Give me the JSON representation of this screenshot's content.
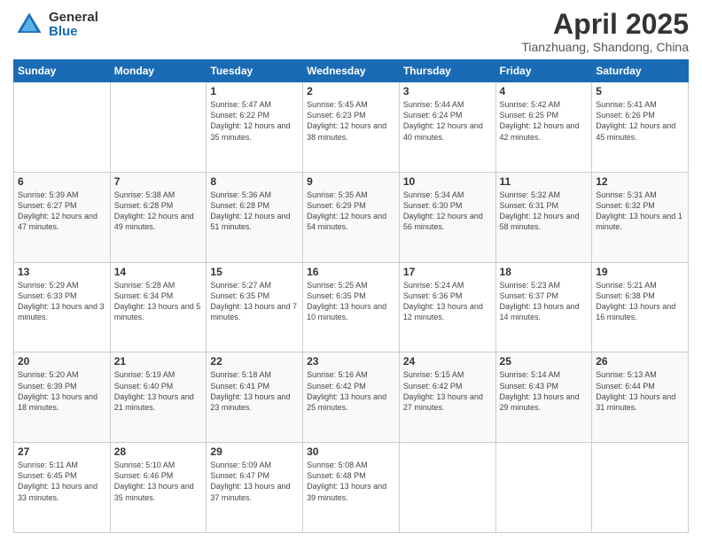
{
  "header": {
    "logo_general": "General",
    "logo_blue": "Blue",
    "title": "April 2025",
    "location": "Tianzhuang, Shandong, China"
  },
  "days_of_week": [
    "Sunday",
    "Monday",
    "Tuesday",
    "Wednesday",
    "Thursday",
    "Friday",
    "Saturday"
  ],
  "weeks": [
    [
      {
        "num": "",
        "info": ""
      },
      {
        "num": "",
        "info": ""
      },
      {
        "num": "1",
        "info": "Sunrise: 5:47 AM\nSunset: 6:22 PM\nDaylight: 12 hours and 35 minutes."
      },
      {
        "num": "2",
        "info": "Sunrise: 5:45 AM\nSunset: 6:23 PM\nDaylight: 12 hours and 38 minutes."
      },
      {
        "num": "3",
        "info": "Sunrise: 5:44 AM\nSunset: 6:24 PM\nDaylight: 12 hours and 40 minutes."
      },
      {
        "num": "4",
        "info": "Sunrise: 5:42 AM\nSunset: 6:25 PM\nDaylight: 12 hours and 42 minutes."
      },
      {
        "num": "5",
        "info": "Sunrise: 5:41 AM\nSunset: 6:26 PM\nDaylight: 12 hours and 45 minutes."
      }
    ],
    [
      {
        "num": "6",
        "info": "Sunrise: 5:39 AM\nSunset: 6:27 PM\nDaylight: 12 hours and 47 minutes."
      },
      {
        "num": "7",
        "info": "Sunrise: 5:38 AM\nSunset: 6:28 PM\nDaylight: 12 hours and 49 minutes."
      },
      {
        "num": "8",
        "info": "Sunrise: 5:36 AM\nSunset: 6:28 PM\nDaylight: 12 hours and 51 minutes."
      },
      {
        "num": "9",
        "info": "Sunrise: 5:35 AM\nSunset: 6:29 PM\nDaylight: 12 hours and 54 minutes."
      },
      {
        "num": "10",
        "info": "Sunrise: 5:34 AM\nSunset: 6:30 PM\nDaylight: 12 hours and 56 minutes."
      },
      {
        "num": "11",
        "info": "Sunrise: 5:32 AM\nSunset: 6:31 PM\nDaylight: 12 hours and 58 minutes."
      },
      {
        "num": "12",
        "info": "Sunrise: 5:31 AM\nSunset: 6:32 PM\nDaylight: 13 hours and 1 minute."
      }
    ],
    [
      {
        "num": "13",
        "info": "Sunrise: 5:29 AM\nSunset: 6:33 PM\nDaylight: 13 hours and 3 minutes."
      },
      {
        "num": "14",
        "info": "Sunrise: 5:28 AM\nSunset: 6:34 PM\nDaylight: 13 hours and 5 minutes."
      },
      {
        "num": "15",
        "info": "Sunrise: 5:27 AM\nSunset: 6:35 PM\nDaylight: 13 hours and 7 minutes."
      },
      {
        "num": "16",
        "info": "Sunrise: 5:25 AM\nSunset: 6:35 PM\nDaylight: 13 hours and 10 minutes."
      },
      {
        "num": "17",
        "info": "Sunrise: 5:24 AM\nSunset: 6:36 PM\nDaylight: 13 hours and 12 minutes."
      },
      {
        "num": "18",
        "info": "Sunrise: 5:23 AM\nSunset: 6:37 PM\nDaylight: 13 hours and 14 minutes."
      },
      {
        "num": "19",
        "info": "Sunrise: 5:21 AM\nSunset: 6:38 PM\nDaylight: 13 hours and 16 minutes."
      }
    ],
    [
      {
        "num": "20",
        "info": "Sunrise: 5:20 AM\nSunset: 6:39 PM\nDaylight: 13 hours and 18 minutes."
      },
      {
        "num": "21",
        "info": "Sunrise: 5:19 AM\nSunset: 6:40 PM\nDaylight: 13 hours and 21 minutes."
      },
      {
        "num": "22",
        "info": "Sunrise: 5:18 AM\nSunset: 6:41 PM\nDaylight: 13 hours and 23 minutes."
      },
      {
        "num": "23",
        "info": "Sunrise: 5:16 AM\nSunset: 6:42 PM\nDaylight: 13 hours and 25 minutes."
      },
      {
        "num": "24",
        "info": "Sunrise: 5:15 AM\nSunset: 6:42 PM\nDaylight: 13 hours and 27 minutes."
      },
      {
        "num": "25",
        "info": "Sunrise: 5:14 AM\nSunset: 6:43 PM\nDaylight: 13 hours and 29 minutes."
      },
      {
        "num": "26",
        "info": "Sunrise: 5:13 AM\nSunset: 6:44 PM\nDaylight: 13 hours and 31 minutes."
      }
    ],
    [
      {
        "num": "27",
        "info": "Sunrise: 5:11 AM\nSunset: 6:45 PM\nDaylight: 13 hours and 33 minutes."
      },
      {
        "num": "28",
        "info": "Sunrise: 5:10 AM\nSunset: 6:46 PM\nDaylight: 13 hours and 35 minutes."
      },
      {
        "num": "29",
        "info": "Sunrise: 5:09 AM\nSunset: 6:47 PM\nDaylight: 13 hours and 37 minutes."
      },
      {
        "num": "30",
        "info": "Sunrise: 5:08 AM\nSunset: 6:48 PM\nDaylight: 13 hours and 39 minutes."
      },
      {
        "num": "",
        "info": ""
      },
      {
        "num": "",
        "info": ""
      },
      {
        "num": "",
        "info": ""
      }
    ]
  ]
}
